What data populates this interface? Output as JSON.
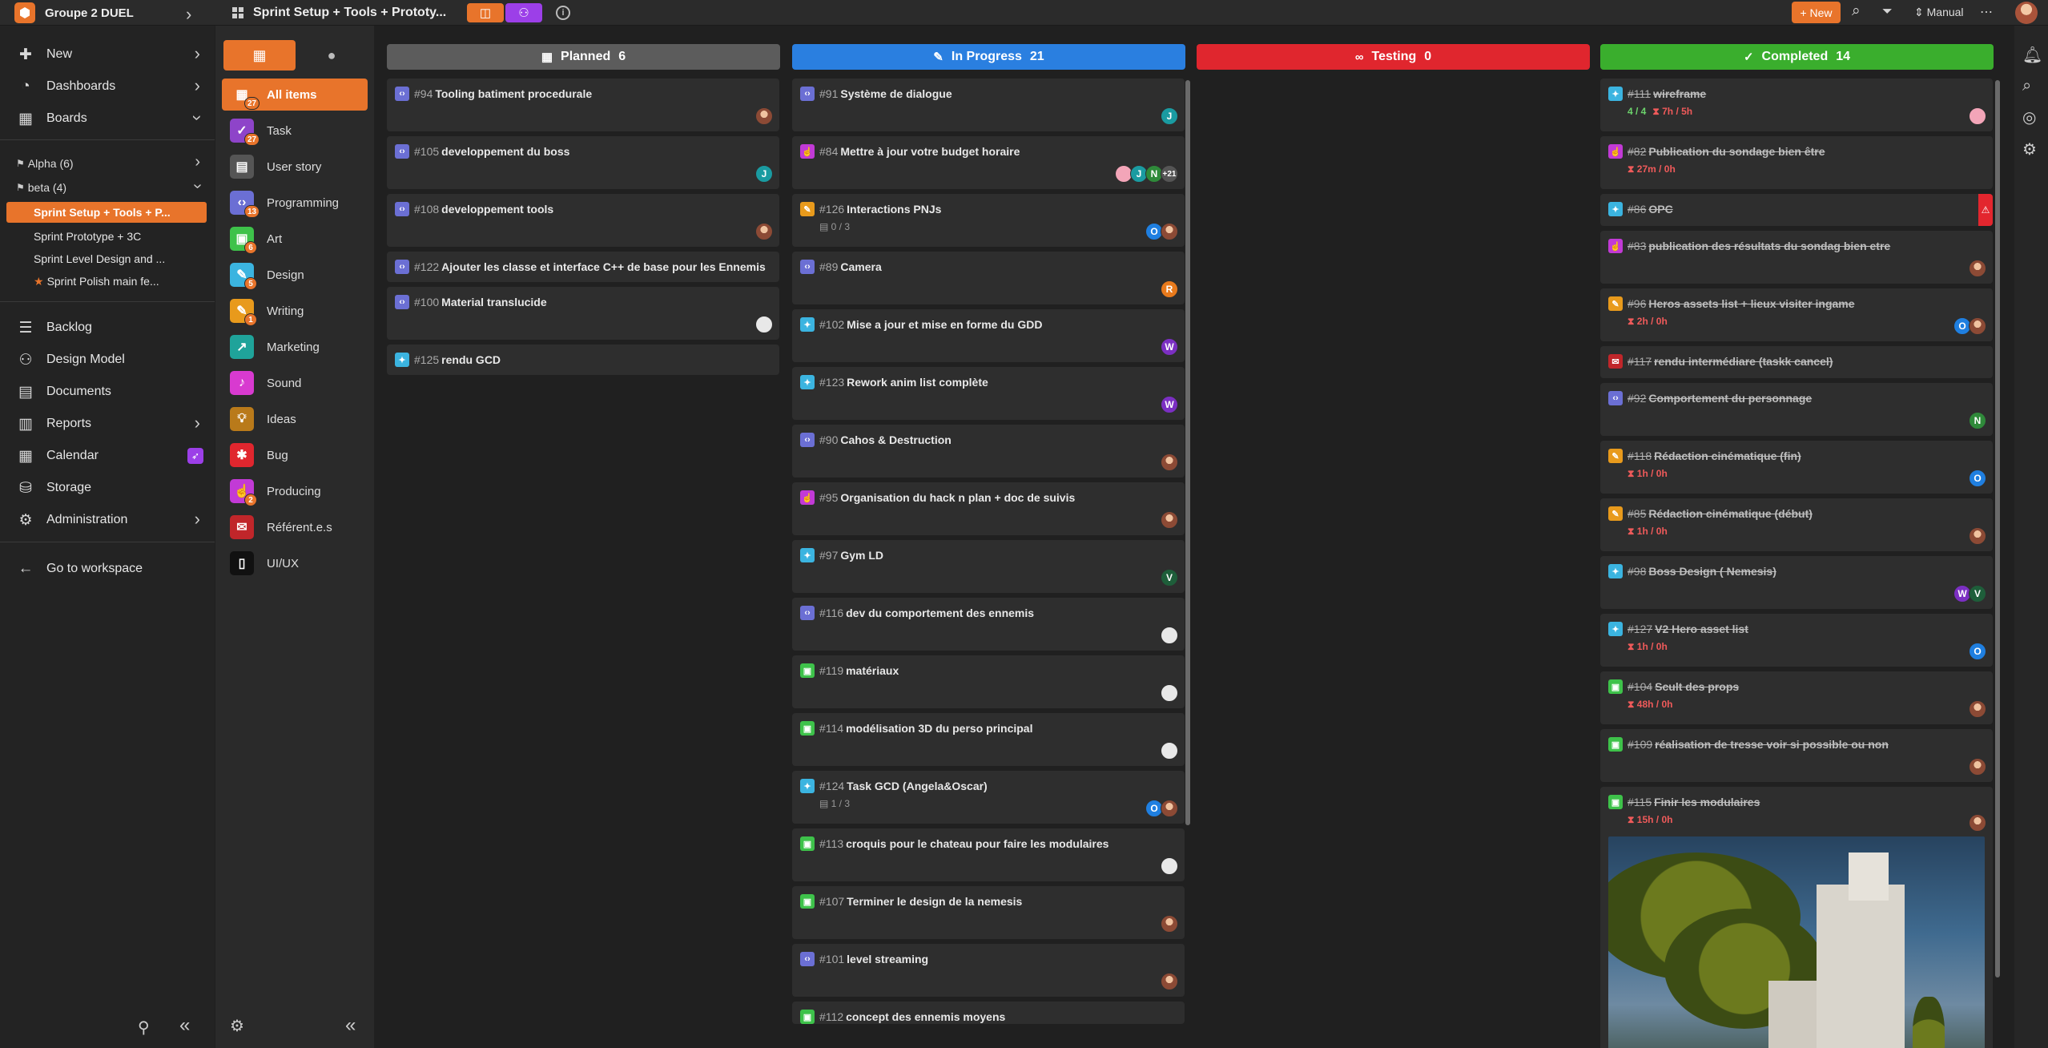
{
  "topbar": {
    "workspace": "Groupe 2 DUEL",
    "breadcrumb_title": "Sprint Setup + Tools + Prototy...",
    "new_label": "+ New",
    "sort_label": "Manual"
  },
  "sidebar": {
    "nav": [
      {
        "label": "New",
        "icon": "plus-icon"
      },
      {
        "label": "Dashboards",
        "icon": "dashboard-icon"
      },
      {
        "label": "Boards",
        "icon": "boards-icon"
      }
    ],
    "boards": [
      {
        "label": "Alpha (6)"
      },
      {
        "label": "beta (4)"
      }
    ],
    "sprints": [
      {
        "label": "Sprint Setup + Tools + P..."
      },
      {
        "label": "Sprint Prototype + 3C"
      },
      {
        "label": "Sprint Level Design and ..."
      },
      {
        "label": "Sprint Polish main fe..."
      }
    ],
    "nav2": [
      {
        "label": "Backlog"
      },
      {
        "label": "Design Model"
      },
      {
        "label": "Documents"
      },
      {
        "label": "Reports"
      },
      {
        "label": "Calendar"
      },
      {
        "label": "Storage"
      },
      {
        "label": "Administration"
      }
    ],
    "go_workspace": "Go to workspace"
  },
  "types": [
    {
      "label": "All items",
      "count": "27",
      "color": "#e8742b"
    },
    {
      "label": "Task",
      "count": "27",
      "color": "#8e44c9"
    },
    {
      "label": "User story",
      "count": "",
      "color": "#555555"
    },
    {
      "label": "Programming",
      "count": "13",
      "color": "#6b6fd4"
    },
    {
      "label": "Art",
      "count": "6",
      "color": "#3ec24a"
    },
    {
      "label": "Design",
      "count": "5",
      "color": "#3bb4e0"
    },
    {
      "label": "Writing",
      "count": "1",
      "color": "#e89a1c"
    },
    {
      "label": "Marketing",
      "count": "",
      "color": "#1fa39a"
    },
    {
      "label": "Sound",
      "count": "",
      "color": "#d83ad0"
    },
    {
      "label": "Ideas",
      "count": "",
      "color": "#b97a1a"
    },
    {
      "label": "Bug",
      "count": "",
      "color": "#e0262e"
    },
    {
      "label": "Producing",
      "count": "2",
      "color": "#c23ad6"
    },
    {
      "label": "Référent.e.s",
      "count": "",
      "color": "#c0262a"
    },
    {
      "label": "UI/UX",
      "count": "",
      "color": "#111111"
    }
  ],
  "columns": [
    {
      "name": "Planned",
      "count": "6",
      "color": "#5c5c5c"
    },
    {
      "name": "In Progress",
      "count": "21",
      "color": "#2a7fe0"
    },
    {
      "name": "Testing",
      "count": "0",
      "color": "#e0262e"
    },
    {
      "name": "Completed",
      "count": "14",
      "color": "#3aae2d"
    }
  ],
  "planned": [
    {
      "num": "#94",
      "title": "Tooling batiment procedurale"
    },
    {
      "num": "#105",
      "title": "developpement du boss"
    },
    {
      "num": "#108",
      "title": "developpement tools"
    },
    {
      "num": "#122",
      "title": "Ajouter les classe et interface C++ de base pour les Ennemis"
    },
    {
      "num": "#100",
      "title": "Material translucide"
    },
    {
      "num": "#125",
      "title": "rendu GCD"
    }
  ],
  "progress": [
    {
      "num": "#91",
      "title": "Système de dialogue",
      "sub": ""
    },
    {
      "num": "#84",
      "title": "Mettre à jour votre budget horaire",
      "sub": "",
      "more": "+21"
    },
    {
      "num": "#126",
      "title": "Interactions PNJs",
      "sub": "0 / 3"
    },
    {
      "num": "#89",
      "title": "Camera",
      "sub": ""
    },
    {
      "num": "#102",
      "title": "Mise a jour et mise en forme du GDD",
      "sub": ""
    },
    {
      "num": "#123",
      "title": "Rework anim list complète",
      "sub": ""
    },
    {
      "num": "#90",
      "title": "Cahos & Destruction",
      "sub": ""
    },
    {
      "num": "#95",
      "title": "Organisation du hack n plan + doc de suivis",
      "sub": ""
    },
    {
      "num": "#97",
      "title": "Gym LD",
      "sub": ""
    },
    {
      "num": "#116",
      "title": "dev du comportement des ennemis",
      "sub": ""
    },
    {
      "num": "#119",
      "title": "matériaux",
      "sub": ""
    },
    {
      "num": "#114",
      "title": "modélisation 3D du perso principal",
      "sub": ""
    },
    {
      "num": "#124",
      "title": "Task GCD (Angela&Oscar)",
      "sub": "1 / 3"
    },
    {
      "num": "#113",
      "title": "croquis pour le chateau pour faire les modulaires",
      "sub": ""
    },
    {
      "num": "#107",
      "title": "Terminer le design de la nemesis",
      "sub": ""
    },
    {
      "num": "#101",
      "title": "level streaming",
      "sub": ""
    },
    {
      "num": "#112",
      "title": "concept des ennemis moyens",
      "sub": ""
    }
  ],
  "completed": [
    {
      "num": "#111",
      "title": "wireframe",
      "check": "4 / 4",
      "time": "7h / 5h"
    },
    {
      "num": "#82",
      "title": "Publication du sondage bien être",
      "time": "27m / 0h"
    },
    {
      "num": "#86",
      "title": "OPC",
      "alert": "⚠"
    },
    {
      "num": "#83",
      "title": "publication des résultats du sondag bien etre"
    },
    {
      "num": "#96",
      "title": "Heros assets list + lieux visiter ingame",
      "time": "2h / 0h"
    },
    {
      "num": "#117",
      "title": "rendu intermédiare (taskk cancel)"
    },
    {
      "num": "#92",
      "title": "Comportement du personnage"
    },
    {
      "num": "#118",
      "title": "Rédaction cinématique (fin)",
      "time": "1h / 0h"
    },
    {
      "num": "#85",
      "title": "Rédaction cinématique (début)",
      "time": "1h / 0h"
    },
    {
      "num": "#98",
      "title": "Boss Design ( Nemesis)"
    },
    {
      "num": "#127",
      "title": "V2 Hero asset list",
      "time": "1h / 0h"
    },
    {
      "num": "#104",
      "title": "Scult des props",
      "time": "48h / 0h"
    },
    {
      "num": "#109",
      "title": "réalisation de tresse voir si possible ou non"
    },
    {
      "num": "#115",
      "title": "Finir les modulaires",
      "time": "15h / 0h"
    }
  ],
  "avatar_letters": {
    "j": "J",
    "n": "N",
    "o": "O",
    "r": "R",
    "w": "W",
    "v": "V"
  }
}
